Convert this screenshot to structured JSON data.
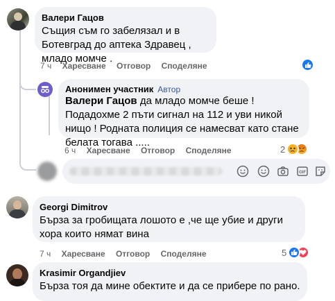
{
  "comments": [
    {
      "author": "Валери Гацов",
      "text": "Същия съм го забелязал и в Ботевград до аптека Здравец , младо момче .",
      "time": "7 ч",
      "like": "Харесване",
      "reply": "Отговор",
      "share": "Споделяне"
    },
    {
      "author": "Анонимен участник",
      "badge": "Автор",
      "mention": "Валери Гацов",
      "text": " да младо момче беше ! Подадохме 2 пъти сигнал на 112 и уви никой нищо ! Родната полиция се намесват като стане белата тогава .....",
      "time": "6 ч",
      "like": "Харесване",
      "reply": "Отговор",
      "share": "Споделяне",
      "reaction_count": "2"
    },
    {
      "author": "Georgi Dimitrov",
      "text": "Бърза за гробищата лошото е ,че ще убие и други хора които нямат вина",
      "time": "7 ч",
      "like": "Харесване",
      "reply": "Отговор",
      "share": "Споделяне",
      "reaction_count": "5"
    },
    {
      "author": "Krasimir Organdjiev",
      "text": "Бърза тоя да мине обектите и да се прибере по рано."
    }
  ],
  "colors": {
    "bubble": "#f0f2f5",
    "meta": "#65676b",
    "like_blue": "#1877f2",
    "love_red": "#f33e58",
    "author_badge": "#385898"
  },
  "icons": [
    "like-icon",
    "sad-icon",
    "angry-icon",
    "love-icon",
    "sticker-icon",
    "emoji-icon",
    "camera-icon",
    "gif-icon",
    "sticker-square-icon"
  ]
}
